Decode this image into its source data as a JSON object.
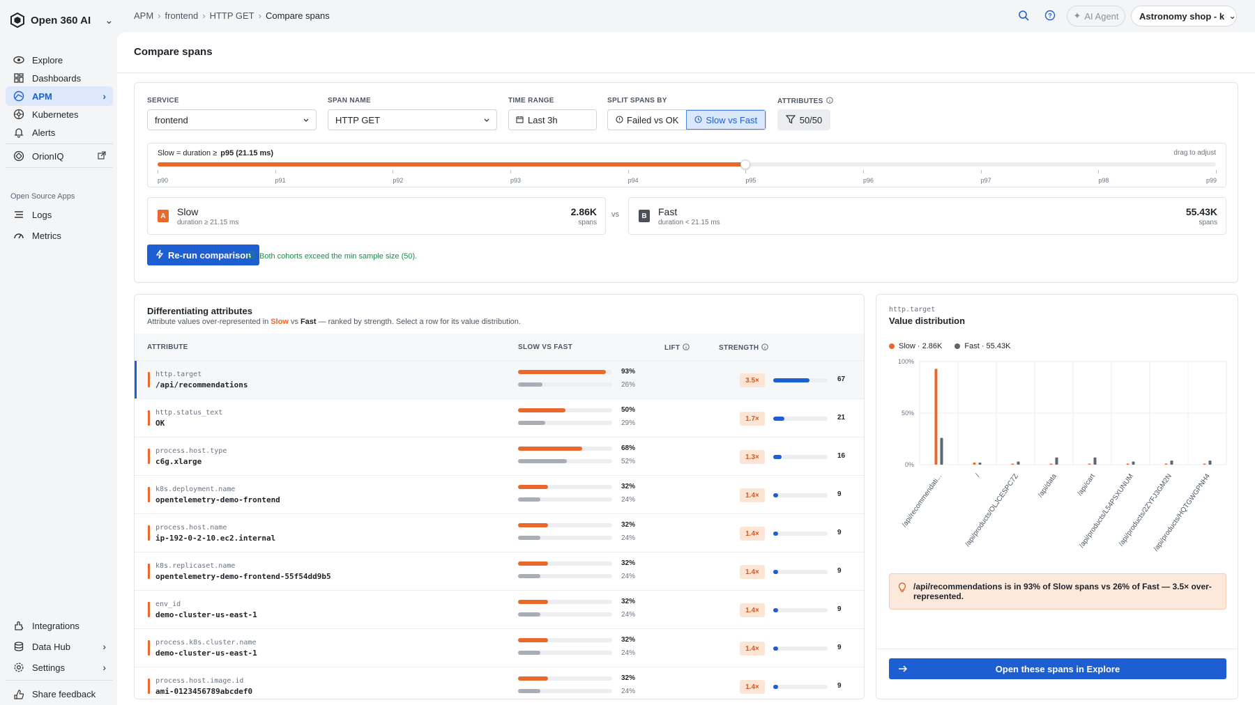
{
  "app": {
    "name": "Open 360 AI"
  },
  "sidebar": {
    "items": [
      {
        "label": "Explore",
        "icon": "eye-icon"
      },
      {
        "label": "Dashboards",
        "icon": "dashboards-icon"
      },
      {
        "label": "APM",
        "icon": "apm-icon",
        "active": true
      },
      {
        "label": "Kubernetes",
        "icon": "kubernetes-icon"
      },
      {
        "label": "Alerts",
        "icon": "bell-icon"
      }
    ],
    "orion": "OrionIQ",
    "section_title": "Open Source Apps",
    "apps": [
      {
        "label": "Logs",
        "icon": "logs-icon"
      },
      {
        "label": "Metrics",
        "icon": "metrics-icon"
      }
    ],
    "bottom": [
      {
        "label": "Integrations",
        "icon": "integrations-icon"
      },
      {
        "label": "Data Hub",
        "icon": "database-icon"
      },
      {
        "label": "Settings",
        "icon": "gear-icon"
      }
    ],
    "feedback": "Share feedback"
  },
  "topbar": {
    "breadcrumb": [
      "APM",
      "frontend",
      "HTTP GET",
      "Compare spans"
    ],
    "ai_agent": "AI Agent",
    "workspace": "Astronomy shop - k"
  },
  "page": {
    "title": "Compare spans"
  },
  "filters": {
    "service_label": "SERVICE",
    "service": "frontend",
    "span_label": "SPAN NAME",
    "span": "HTTP GET",
    "time_label": "TIME RANGE",
    "time": "Last 3h",
    "split_label": "SPLIT SPANS BY",
    "split_a": "Failed vs OK",
    "split_b": "Slow vs Fast",
    "attributes_label": "ATTRIBUTES",
    "attributes": "50/50"
  },
  "threshold": {
    "label_prefix": "Slow = duration ≥",
    "label_value": "p95 (21.15 ms)",
    "hint": "drag to adjust",
    "ticks": [
      "p90",
      "p91",
      "p92",
      "p93",
      "p94",
      "p95",
      "p96",
      "p97",
      "p98",
      "p99"
    ],
    "selected_fraction": 0.5555
  },
  "cohorts": {
    "a": {
      "badge": "A",
      "name": "Slow",
      "sub": "duration ≥ 21.15 ms",
      "count": "2.86K",
      "unit": "spans"
    },
    "vs": "vs",
    "b": {
      "badge": "B",
      "name": "Fast",
      "sub": "duration < 21.15 ms",
      "count": "55.43K",
      "unit": "spans"
    }
  },
  "actions": {
    "rerun": "Re-run comparison",
    "ok": "Both cohorts exceed the min sample size (50)."
  },
  "diff": {
    "title": "Differentiating attributes",
    "sub_prefix": "Attribute values over-represented in",
    "sub_slow": "Slow",
    "sub_vs": "vs",
    "sub_fast": "Fast",
    "sub_suffix": "— ranked by strength. Select a row for its value distribution.",
    "headers": {
      "attribute": "ATTRIBUTE",
      "svf": "SLOW VS FAST",
      "lift": "LIFT",
      "strength": "STRENGTH"
    },
    "rows": [
      {
        "key": "http.target",
        "value": "/api/recommendations",
        "slow": 93,
        "fast": 26,
        "slow_t": "93%",
        "fast_t": "26%",
        "lift": "3.5×",
        "strength": 67
      },
      {
        "key": "http.status_text",
        "value": "OK",
        "slow": 50,
        "fast": 29,
        "slow_t": "50%",
        "fast_t": "29%",
        "lift": "1.7×",
        "strength": 21
      },
      {
        "key": "process.host.type",
        "value": "c6g.xlarge",
        "slow": 68,
        "fast": 52,
        "slow_t": "68%",
        "fast_t": "52%",
        "lift": "1.3×",
        "strength": 16
      },
      {
        "key": "k8s.deployment.name",
        "value": "opentelemetry-demo-frontend",
        "slow": 32,
        "fast": 24,
        "slow_t": "32%",
        "fast_t": "24%",
        "lift": "1.4×",
        "strength": 9
      },
      {
        "key": "process.host.name",
        "value": "ip-192-0-2-10.ec2.internal",
        "slow": 32,
        "fast": 24,
        "slow_t": "32%",
        "fast_t": "24%",
        "lift": "1.4×",
        "strength": 9
      },
      {
        "key": "k8s.replicaset.name",
        "value": "opentelemetry-demo-frontend-55f54dd9b5",
        "slow": 32,
        "fast": 24,
        "slow_t": "32%",
        "fast_t": "24%",
        "lift": "1.4×",
        "strength": 9
      },
      {
        "key": "env_id",
        "value": "demo-cluster-us-east-1",
        "slow": 32,
        "fast": 24,
        "slow_t": "32%",
        "fast_t": "24%",
        "lift": "1.4×",
        "strength": 9
      },
      {
        "key": "process.k8s.cluster.name",
        "value": "demo-cluster-us-east-1",
        "slow": 32,
        "fast": 24,
        "slow_t": "32%",
        "fast_t": "24%",
        "lift": "1.4×",
        "strength": 9
      },
      {
        "key": "process.host.image.id",
        "value": "ami-0123456789abcdef0",
        "slow": 32,
        "fast": 24,
        "slow_t": "32%",
        "fast_t": "24%",
        "lift": "1.4×",
        "strength": 9
      }
    ]
  },
  "dist": {
    "key": "http.target",
    "title": "Value distribution",
    "legend_slow": "Slow · 2.86K",
    "legend_fast": "Fast · 55.43K",
    "insight": "/api/recommendations is in 93% of Slow spans vs 26% of Fast — 3.5× over-represented.",
    "open": "Open these spans in Explore"
  },
  "chart_data": {
    "type": "bar",
    "categories": [
      "/api/recommendati...",
      "/",
      "/api/products/OLJCESPC7Z",
      "/api/data",
      "/api/cart",
      "/api/products/L54PSXUNUM",
      "/api/products/2ZYFJ3GM2N",
      "/api/products/HQTGWGPNH4"
    ],
    "series": [
      {
        "name": "Slow · 2.86K",
        "values": [
          93,
          2,
          1,
          1,
          1,
          1,
          1,
          1
        ],
        "color": "#e8692b"
      },
      {
        "name": "Fast · 55.43K",
        "values": [
          26,
          2,
          3,
          7,
          7,
          3,
          4,
          4
        ],
        "color": "#5f6670"
      }
    ],
    "yticks": [
      "100%",
      "50%",
      "0%"
    ],
    "ylim": [
      0,
      100
    ],
    "legend": "top-left"
  },
  "colors": {
    "accent": "#1d5fd3",
    "slow": "#e8692b",
    "fast": "#5f6670"
  }
}
